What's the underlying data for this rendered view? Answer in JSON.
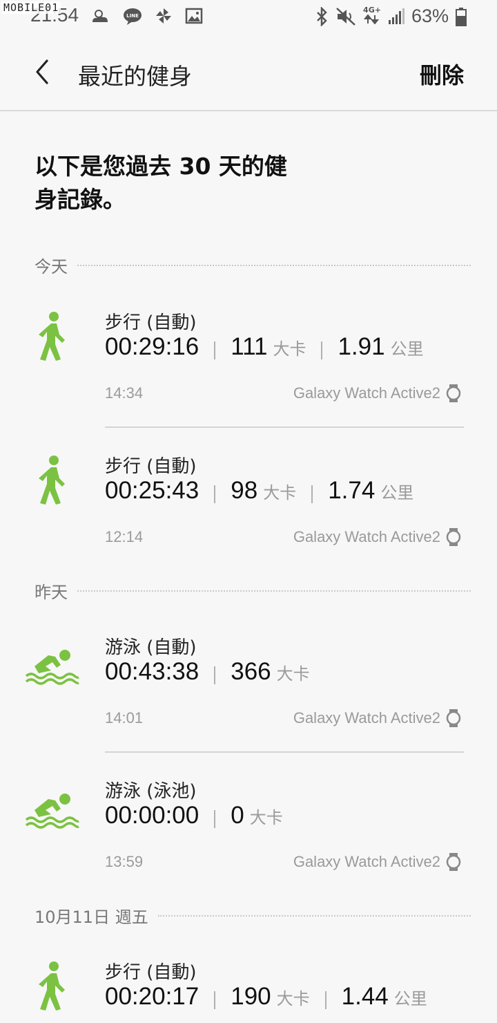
{
  "status_bar": {
    "watermark": "MOBILE01",
    "time": "21:54",
    "battery": "63%",
    "network": "4G+"
  },
  "header": {
    "title": "最近的健身",
    "delete_label": "刪除"
  },
  "intro": {
    "line1": "以下是您過去 30 天的健",
    "line2": "身記錄。"
  },
  "colors": {
    "accent": "#7cc242",
    "background": "#f7f7f7"
  },
  "sections": [
    {
      "label": "今天",
      "workouts": [
        {
          "icon": "walking-icon",
          "name": "步行 (自動)",
          "duration": "00:29:16",
          "calories": "111",
          "calories_unit": "大卡",
          "distance": "1.91",
          "distance_unit": "公里",
          "time": "14:34",
          "device": "Galaxy Watch Active2"
        },
        {
          "icon": "walking-icon",
          "name": "步行 (自動)",
          "duration": "00:25:43",
          "calories": "98",
          "calories_unit": "大卡",
          "distance": "1.74",
          "distance_unit": "公里",
          "time": "12:14",
          "device": "Galaxy Watch Active2"
        }
      ]
    },
    {
      "label": "昨天",
      "workouts": [
        {
          "icon": "swimming-icon",
          "name": "游泳 (自動)",
          "duration": "00:43:38",
          "calories": "366",
          "calories_unit": "大卡",
          "time": "14:01",
          "device": "Galaxy Watch Active2"
        },
        {
          "icon": "swimming-icon",
          "name": "游泳 (泳池)",
          "duration": "00:00:00",
          "calories": "0",
          "calories_unit": "大卡",
          "time": "13:59",
          "device": "Galaxy Watch Active2"
        }
      ]
    },
    {
      "label": "10月11日 週五",
      "workouts": [
        {
          "icon": "walking-icon",
          "name": "步行 (自動)",
          "duration": "00:20:17",
          "calories": "190",
          "calories_unit": "大卡",
          "distance": "1.44",
          "distance_unit": "公里"
        }
      ]
    }
  ]
}
